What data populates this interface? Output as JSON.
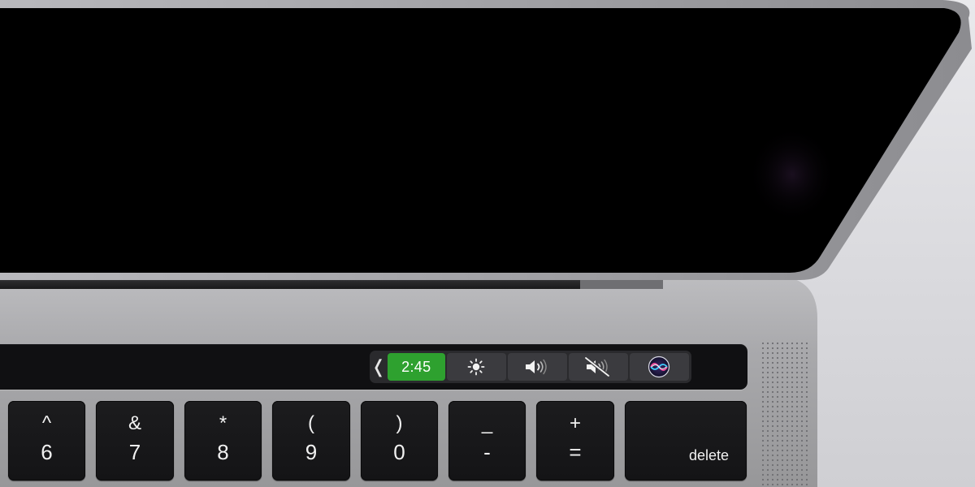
{
  "touch_bar": {
    "collapse_glyph": "❬",
    "time": "2:45",
    "time_color": "#2ea12f",
    "buttons": [
      {
        "icon": "brightness-icon"
      },
      {
        "icon": "volume-icon"
      },
      {
        "icon": "mute-icon"
      },
      {
        "icon": "siri-icon"
      }
    ]
  },
  "keyboard": {
    "number_keys": [
      {
        "shift": "^",
        "base": "6"
      },
      {
        "shift": "&",
        "base": "7"
      },
      {
        "shift": "*",
        "base": "8"
      },
      {
        "shift": "(",
        "base": "9"
      },
      {
        "shift": ")",
        "base": "0"
      },
      {
        "shift": "_",
        "base": "-"
      },
      {
        "shift": "+",
        "base": "="
      }
    ],
    "delete_label": "delete"
  },
  "colors": {
    "body": "#a5a5a8",
    "screen": "#000000",
    "background": "#dadade"
  }
}
